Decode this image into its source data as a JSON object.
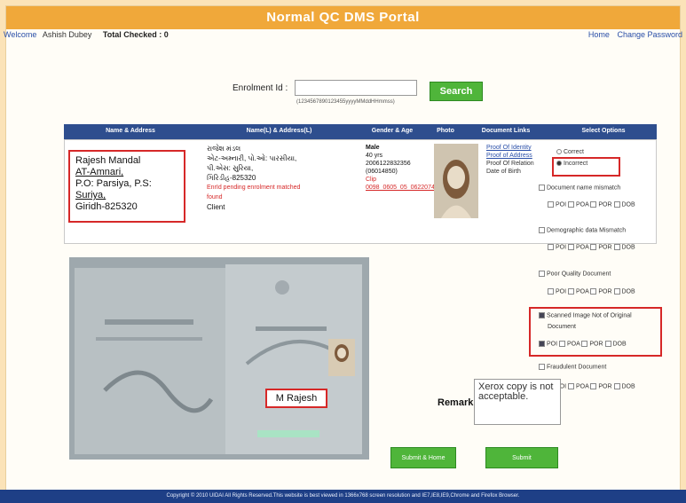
{
  "header": {
    "title": "Normal QC DMS Portal"
  },
  "user": {
    "welcome_label": "Welcome",
    "name": "Ashish Dubey",
    "total_checked": "Total Checked : 0"
  },
  "nav": {
    "home": "Home",
    "change_password": "Change Password"
  },
  "search": {
    "label": "Enrolment Id :",
    "value": "",
    "hint": "(1234567890123455yyyyMMddHHmmss)",
    "button": "Search"
  },
  "table": {
    "headers": [
      "Name & Address",
      "Name(L) & Address(L)",
      "Gender & Age",
      "Photo",
      "Document Links",
      "Select Options"
    ]
  },
  "record": {
    "address": [
      "Rajesh Mandal",
      "AT-Amnari,",
      "P.O: Parsiya, P.S:",
      "Suriya,",
      "Giridh-825320"
    ],
    "local": {
      "line1": "રાજેશ મંડલ",
      "line2": "એટ-અમ્નારી, પો.ઓ: પારસીયા,",
      "line3": "પી.એસ: સુરિયા,",
      "line4": "ગિરિડીહ-825320",
      "red1": "EnrId pending enrolment matched",
      "red2": "found",
      "client": "Client"
    },
    "gender": "Male",
    "age": "40 yrs",
    "id1": "2006122832356",
    "id2": "(06014850)",
    "red_label": "Clip",
    "red_link": "0098_0605_05_0622074"
  },
  "doc_links": {
    "poi": "Proof Of Identity",
    "poa": "Proof of Address",
    "por": "Proof Of Relation",
    "dob": "Date of Birth"
  },
  "options": {
    "correct": "Correct",
    "incorrect": "Incorrect",
    "doc_name_mismatch": "Document name mismatch",
    "demo_mismatch": "Demographic data Mismatch",
    "poor_quality": "Poor Quality Document",
    "scanned_not_original_1": "Scanned Image Not of Original",
    "scanned_not_original_2": "Document",
    "fraudulent": "Fraudulent Document",
    "poi": "POI",
    "poa": "POA",
    "por": "POR",
    "dob": "DOB"
  },
  "document_image": {
    "name_label": "M Rajesh"
  },
  "remark": {
    "label": "Remark:",
    "value": "Xerox copy is not acceptable."
  },
  "buttons": {
    "submit_home": "Submit & Home",
    "submit": "Submit"
  },
  "footer": {
    "text": "Copyright © 2010 UIDAI All Rights Reserved.This website is best viewed in 1366x768 screen resolution and IE7,IE8,IE9,Chrome and Firefox Browser."
  }
}
